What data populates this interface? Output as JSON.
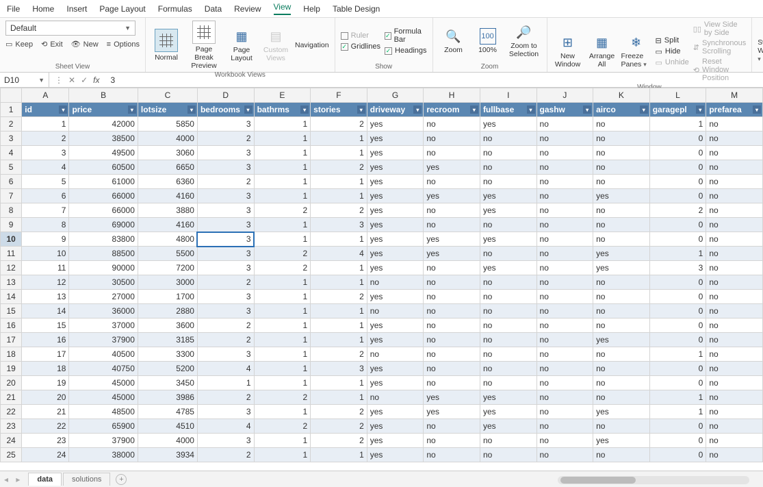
{
  "menu": [
    "File",
    "Home",
    "Insert",
    "Page Layout",
    "Formulas",
    "Data",
    "Review",
    "View",
    "Help",
    "Table Design"
  ],
  "active_menu": "View",
  "ribbon": {
    "default_label": "Default",
    "keep": "Keep",
    "exit": "Exit",
    "new": "New",
    "options": "Options",
    "group_sheetview": "Sheet View",
    "normal": "Normal",
    "page_break": "Page Break Preview",
    "page_layout": "Page Layout",
    "custom_views": "Custom Views",
    "navigation": "Navigation",
    "group_workbook": "Workbook Views",
    "ruler": "Ruler",
    "formula_bar": "Formula Bar",
    "gridlines": "Gridlines",
    "headings": "Headings",
    "group_show": "Show",
    "zoom": "Zoom",
    "hundred": "100%",
    "zoom_sel": "Zoom to Selection",
    "group_zoom": "Zoom",
    "new_window": "New Window",
    "arrange_all": "Arrange All",
    "freeze": "Freeze Panes",
    "split": "Split",
    "hide": "Hide",
    "unhide": "Unhide",
    "side": "View Side by Side",
    "sync": "Synchronous Scrolling",
    "reset": "Reset Window Position",
    "group_window": "Window",
    "switch": "Switch Windows"
  },
  "cell_ref": "D10",
  "formula_value": "3",
  "columns": [
    "A",
    "B",
    "C",
    "D",
    "E",
    "F",
    "G",
    "H",
    "I",
    "J",
    "K",
    "L",
    "M"
  ],
  "headers": [
    "id",
    "price",
    "lotsize",
    "bedrooms",
    "bathrms",
    "stories",
    "driveway",
    "recroom",
    "fullbase",
    "gashw",
    "airco",
    "garagepl",
    "prefarea"
  ],
  "rows": [
    [
      1,
      42000,
      5850,
      3,
      1,
      2,
      "yes",
      "no",
      "yes",
      "no",
      "no",
      1,
      "no"
    ],
    [
      2,
      38500,
      4000,
      2,
      1,
      1,
      "yes",
      "no",
      "no",
      "no",
      "no",
      0,
      "no"
    ],
    [
      3,
      49500,
      3060,
      3,
      1,
      1,
      "yes",
      "no",
      "no",
      "no",
      "no",
      0,
      "no"
    ],
    [
      4,
      60500,
      6650,
      3,
      1,
      2,
      "yes",
      "yes",
      "no",
      "no",
      "no",
      0,
      "no"
    ],
    [
      5,
      61000,
      6360,
      2,
      1,
      1,
      "yes",
      "no",
      "no",
      "no",
      "no",
      0,
      "no"
    ],
    [
      6,
      66000,
      4160,
      3,
      1,
      1,
      "yes",
      "yes",
      "yes",
      "no",
      "yes",
      0,
      "no"
    ],
    [
      7,
      66000,
      3880,
      3,
      2,
      2,
      "yes",
      "no",
      "yes",
      "no",
      "no",
      2,
      "no"
    ],
    [
      8,
      69000,
      4160,
      3,
      1,
      3,
      "yes",
      "no",
      "no",
      "no",
      "no",
      0,
      "no"
    ],
    [
      9,
      83800,
      4800,
      3,
      1,
      1,
      "yes",
      "yes",
      "yes",
      "no",
      "no",
      0,
      "no"
    ],
    [
      10,
      88500,
      5500,
      3,
      2,
      4,
      "yes",
      "yes",
      "no",
      "no",
      "yes",
      1,
      "no"
    ],
    [
      11,
      90000,
      7200,
      3,
      2,
      1,
      "yes",
      "no",
      "yes",
      "no",
      "yes",
      3,
      "no"
    ],
    [
      12,
      30500,
      3000,
      2,
      1,
      1,
      "no",
      "no",
      "no",
      "no",
      "no",
      0,
      "no"
    ],
    [
      13,
      27000,
      1700,
      3,
      1,
      2,
      "yes",
      "no",
      "no",
      "no",
      "no",
      0,
      "no"
    ],
    [
      14,
      36000,
      2880,
      3,
      1,
      1,
      "no",
      "no",
      "no",
      "no",
      "no",
      0,
      "no"
    ],
    [
      15,
      37000,
      3600,
      2,
      1,
      1,
      "yes",
      "no",
      "no",
      "no",
      "no",
      0,
      "no"
    ],
    [
      16,
      37900,
      3185,
      2,
      1,
      1,
      "yes",
      "no",
      "no",
      "no",
      "yes",
      0,
      "no"
    ],
    [
      17,
      40500,
      3300,
      3,
      1,
      2,
      "no",
      "no",
      "no",
      "no",
      "no",
      1,
      "no"
    ],
    [
      18,
      40750,
      5200,
      4,
      1,
      3,
      "yes",
      "no",
      "no",
      "no",
      "no",
      0,
      "no"
    ],
    [
      19,
      45000,
      3450,
      1,
      1,
      1,
      "yes",
      "no",
      "no",
      "no",
      "no",
      0,
      "no"
    ],
    [
      20,
      45000,
      3986,
      2,
      2,
      1,
      "no",
      "yes",
      "yes",
      "no",
      "no",
      1,
      "no"
    ],
    [
      21,
      48500,
      4785,
      3,
      1,
      2,
      "yes",
      "yes",
      "yes",
      "no",
      "yes",
      1,
      "no"
    ],
    [
      22,
      65900,
      4510,
      4,
      2,
      2,
      "yes",
      "no",
      "yes",
      "no",
      "no",
      0,
      "no"
    ],
    [
      23,
      37900,
      4000,
      3,
      1,
      2,
      "yes",
      "no",
      "no",
      "no",
      "yes",
      0,
      "no"
    ],
    [
      24,
      38000,
      3934,
      2,
      1,
      1,
      "yes",
      "no",
      "no",
      "no",
      "no",
      0,
      "no"
    ]
  ],
  "selected_cell": {
    "row": 10,
    "col": 3
  },
  "tabs": {
    "active": "data",
    "others": [
      "solutions"
    ]
  }
}
